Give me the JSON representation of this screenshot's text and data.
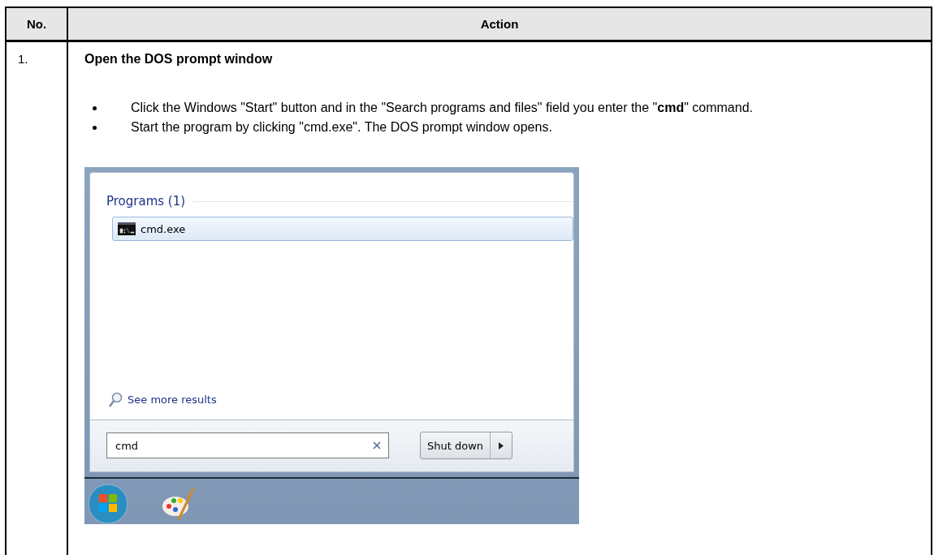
{
  "table": {
    "columns": [
      "No.",
      "Action"
    ],
    "rows": [
      {
        "number": "1.",
        "title": "Open the DOS prompt window",
        "bullets": [
          "Click the Windows \"Start\" button and in the \"Search programs and files\" field you enter the \"**cmd**\" command.",
          "Start the program by clicking \"cmd.exe\". The DOS prompt window opens."
        ],
        "screenshot": {
          "section": "Programs (1)",
          "results": [
            {
              "label": "cmd.exe",
              "selected": true
            }
          ],
          "more_link": "See more results",
          "search": {
            "value": "cmd"
          },
          "shutdown": "Shut down"
        }
      }
    ]
  }
}
